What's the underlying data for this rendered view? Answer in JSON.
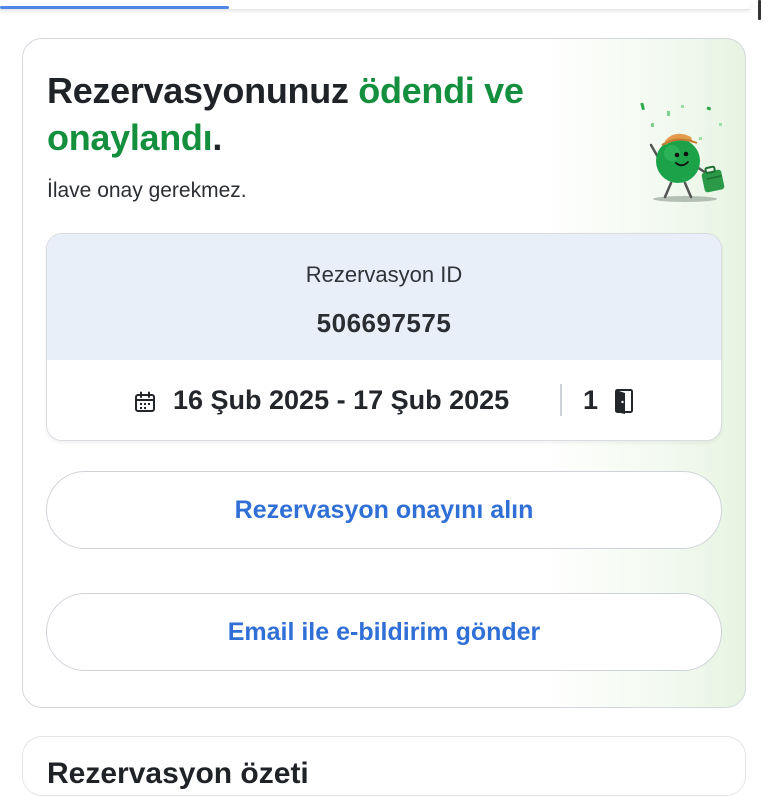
{
  "progress": {
    "fraction": 0.305,
    "color": "#4f86e8"
  },
  "confirmation": {
    "title_part1": "Rezervasyonunuz ",
    "title_part2": "ödendi ve onaylandı",
    "title_part3": ".",
    "subtitle": "İlave onay gerekmez.",
    "accent_color": "#138f3e",
    "illustration": "celebrating-mascot-with-suitcase"
  },
  "booking": {
    "id_label": "Rezervasyon ID",
    "id_value": "506697575",
    "dates": "16 Şub 2025 - 17 Şub 2025",
    "room_count": "1",
    "calendar_icon": "calendar-icon",
    "room_icon": "door-icon"
  },
  "actions": {
    "get_confirmation": "Rezervasyon onayını alın",
    "send_email": "Email ile e-bildirim gönder",
    "link_color": "#2f6fd6"
  },
  "next_section": {
    "title": "Rezervasyon özeti"
  }
}
